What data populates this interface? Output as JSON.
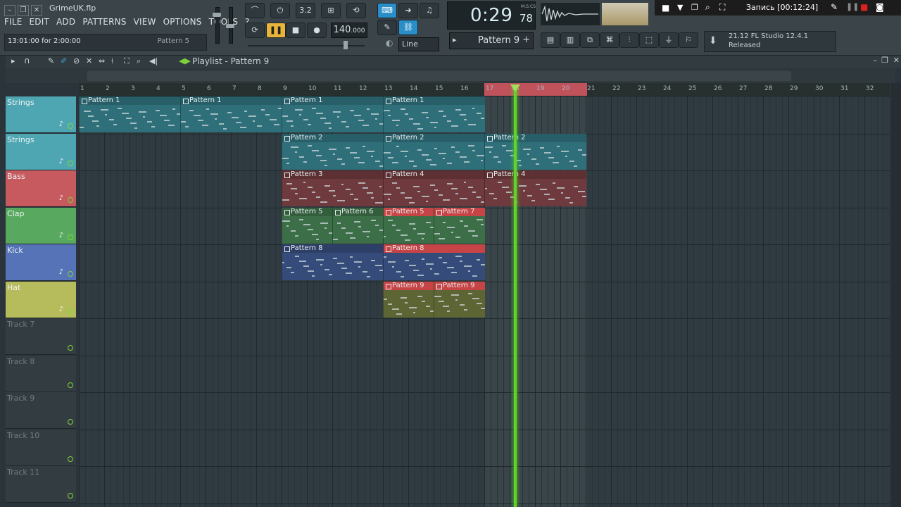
{
  "window": {
    "filename": "GrimeUK.flp"
  },
  "menu": [
    "FILE",
    "EDIT",
    "ADD",
    "PATTERNS",
    "VIEW",
    "OPTIONS",
    "TOOLS",
    "?"
  ],
  "hint": {
    "left": "13:01:00 for 2:00:00",
    "right": "Pattern 5"
  },
  "transport": {
    "tempo": "140",
    "tempo_dec": ".000",
    "time": "0:29",
    "time_ms": "78",
    "time_label": "M:S:CS",
    "snap": "Line"
  },
  "pattern_selector": {
    "label": "Pattern 9"
  },
  "recording": {
    "label": "Запись [00:12:24]"
  },
  "hint_panel": {
    "version": "21.12  FL Studio 12.4.1",
    "status": "Released"
  },
  "playlist": {
    "title": "Playlist - Pattern 9"
  },
  "ruler": {
    "ticks": [
      "1",
      "2",
      "3",
      "4",
      "5",
      "6",
      "7",
      "8",
      "9",
      "10",
      "11",
      "12",
      "13",
      "14",
      "15",
      "16",
      "17",
      "18",
      "19",
      "20",
      "21",
      "22",
      "23",
      "24",
      "25",
      "26",
      "27",
      "28",
      "29",
      "30",
      "31",
      "32"
    ]
  },
  "colors": {
    "strings": "#3f8a94",
    "bass": "#b8555a",
    "clap": "#4f9a5c",
    "kick": "#4f6aa8",
    "hat": "#a8ac52",
    "empty": "#2e373c",
    "selected": "#c74446"
  },
  "tracks": [
    {
      "name": "Strings",
      "icon": "violin-icon",
      "color": "#4fa6b3",
      "empty": false
    },
    {
      "name": "Strings",
      "icon": "violin-icon",
      "color": "#4fa6b3",
      "empty": false
    },
    {
      "name": "Bass",
      "icon": "bass-clef-icon",
      "color": "#c65a5f",
      "empty": false
    },
    {
      "name": "Clap",
      "icon": "hand-icon",
      "color": "#58a95f",
      "empty": false
    },
    {
      "name": "Kick",
      "icon": "kick-drum-icon",
      "color": "#5673b8",
      "empty": false
    },
    {
      "name": "Hat",
      "icon": "hat-icon",
      "color": "#b6bc5b",
      "empty": false
    },
    {
      "name": "Track 7",
      "icon": "",
      "color": "#333c41",
      "empty": true
    },
    {
      "name": "Track 8",
      "icon": "",
      "color": "#333c41",
      "empty": true
    },
    {
      "name": "Track 9",
      "icon": "",
      "color": "#333c41",
      "empty": true
    },
    {
      "name": "Track 10",
      "icon": "",
      "color": "#333c41",
      "empty": true
    },
    {
      "name": "Track 11",
      "icon": "",
      "color": "#333c41",
      "empty": true
    }
  ],
  "clips": [
    {
      "track": 0,
      "start": 1,
      "len": 4,
      "label": "Pattern 1",
      "color": "#2f6f79"
    },
    {
      "track": 0,
      "start": 5,
      "len": 4,
      "label": "Pattern 1",
      "color": "#2f6f79"
    },
    {
      "track": 0,
      "start": 9,
      "len": 4,
      "label": "Pattern 1",
      "color": "#2f6f79"
    },
    {
      "track": 0,
      "start": 13,
      "len": 4,
      "label": "Pattern 1",
      "color": "#2f6f79"
    },
    {
      "track": 1,
      "start": 9,
      "len": 4,
      "label": "Pattern 2",
      "color": "#2f6f79"
    },
    {
      "track": 1,
      "start": 13,
      "len": 4,
      "label": "Pattern 2",
      "color": "#2f6f79"
    },
    {
      "track": 1,
      "start": 17,
      "len": 4,
      "label": "Pattern 2",
      "color": "#2f6f79"
    },
    {
      "track": 2,
      "start": 9,
      "len": 4,
      "label": "Pattern 3",
      "color": "#6e3a3d"
    },
    {
      "track": 2,
      "start": 13,
      "len": 4,
      "label": "Pattern 4",
      "color": "#6e3a3d"
    },
    {
      "track": 2,
      "start": 17,
      "len": 4,
      "label": "Pattern 4",
      "color": "#6e3a3d"
    },
    {
      "track": 3,
      "start": 9,
      "len": 2,
      "label": "Pattern 5",
      "color": "#3c6f47"
    },
    {
      "track": 3,
      "start": 11,
      "len": 2,
      "label": "Pattern 6",
      "color": "#3c6f47"
    },
    {
      "track": 3,
      "start": 13,
      "len": 2,
      "label": "Pattern 5",
      "color": "#3c6f47",
      "selected": true
    },
    {
      "track": 3,
      "start": 15,
      "len": 2,
      "label": "Pattern 7",
      "color": "#3c6f47",
      "selected": true
    },
    {
      "track": 4,
      "start": 9,
      "len": 4,
      "label": "Pattern 8",
      "color": "#354b79"
    },
    {
      "track": 4,
      "start": 13,
      "len": 4,
      "label": "Pattern 8",
      "color": "#354b79",
      "selected": true
    },
    {
      "track": 5,
      "start": 13,
      "len": 2,
      "label": "Pattern 9",
      "color": "#5e6534",
      "selected": true
    },
    {
      "track": 5,
      "start": 15,
      "len": 2,
      "label": "Pattern 9",
      "color": "#5e6534",
      "selected": true
    }
  ]
}
